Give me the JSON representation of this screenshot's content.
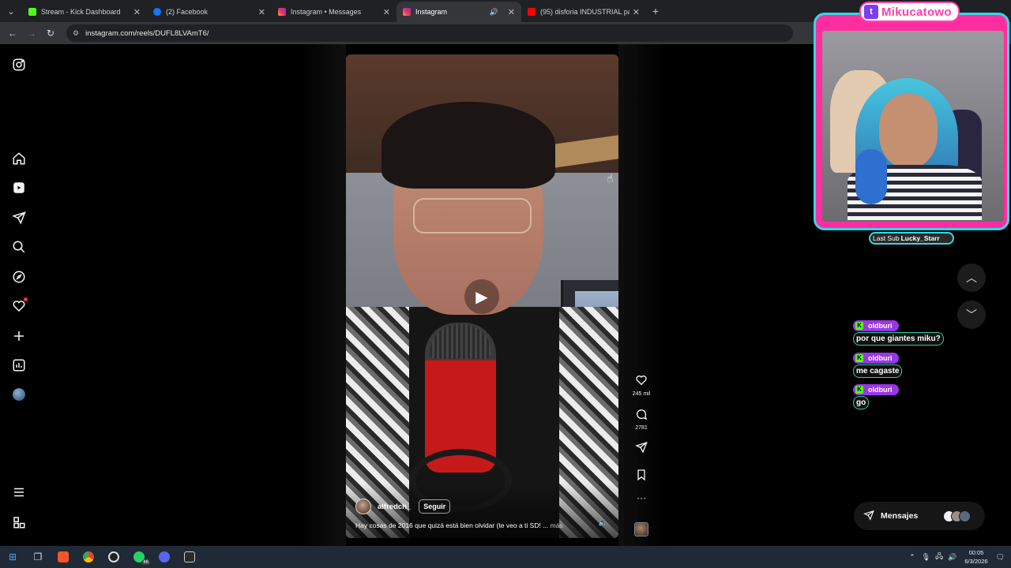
{
  "browser": {
    "tabs": [
      {
        "title": "Stream - Kick Dashboard",
        "color": "#53fc18"
      },
      {
        "title": "(2) Facebook",
        "color": "#1877f2"
      },
      {
        "title": "Instagram • Messages",
        "color": "#e1306c"
      },
      {
        "title": "Instagram",
        "color": "#e1306c",
        "active": true
      },
      {
        "title": "(95) disforia INDUSTRIAL park",
        "color": "#ff0000"
      }
    ],
    "url": "instagram.com/reels/DUFL8LVAmT6/"
  },
  "sidebar": {
    "icons": [
      "instagram-icon",
      "home-icon",
      "reels-icon",
      "direct-icon",
      "search-icon",
      "explore-icon",
      "notifications-icon",
      "create-icon",
      "dashboard-icon",
      "profile-icon",
      "menu-icon",
      "more-apps-icon"
    ]
  },
  "reel": {
    "username": "alfredch_",
    "follow_label": "Seguir",
    "caption": "Hay cosas de 2016 que quizá está bien olvidar (te veo a ti SD! ...",
    "more_label": "más",
    "likes": "245 mil",
    "comments": "2781"
  },
  "messages": {
    "label": "Mensajes"
  },
  "overlay": {
    "channel": "Mikucatowo",
    "last_sub_label": "Last Sub",
    "last_sub_user": "Lucky_Starr"
  },
  "chat": [
    {
      "user": "oldburi",
      "message": "por que giantes miku?"
    },
    {
      "user": "oldburi",
      "message": "me cagaste"
    },
    {
      "user": "oldburi",
      "message": "go"
    }
  ],
  "taskbar": {
    "whatsapp_badge": "46",
    "time": "00:05",
    "date": "6/3/2026"
  },
  "colors": {
    "accent_pink": "#ff2ea0",
    "accent_cyan": "#35d7e6",
    "kick_green": "#53fc18",
    "chat_purple": "#9a36e6"
  }
}
